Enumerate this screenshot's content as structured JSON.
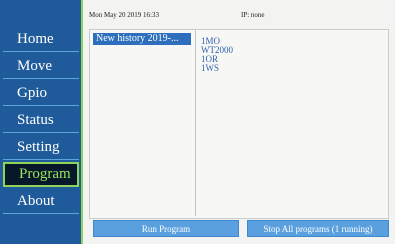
{
  "sidebar": {
    "items": [
      {
        "label": "Home"
      },
      {
        "label": "Move"
      },
      {
        "label": "Gpio"
      },
      {
        "label": "Status"
      },
      {
        "label": "Setting"
      },
      {
        "label": "Program"
      },
      {
        "label": "About"
      }
    ],
    "active_index": 5,
    "accent_color": "#8fd35a",
    "background_color": "#1f5b9a"
  },
  "header": {
    "datetime": "Mon May 20 2019 16:33",
    "ip": "IP: none"
  },
  "program_list": {
    "items": [
      {
        "label": "New history 2019-..."
      }
    ],
    "selected_index": 0
  },
  "program_details": {
    "lines": [
      "1MO",
      "WT2000",
      "1OR",
      "1WS"
    ]
  },
  "buttons": {
    "run": "Run Program",
    "stop": "Stop All programs (1 running)"
  }
}
